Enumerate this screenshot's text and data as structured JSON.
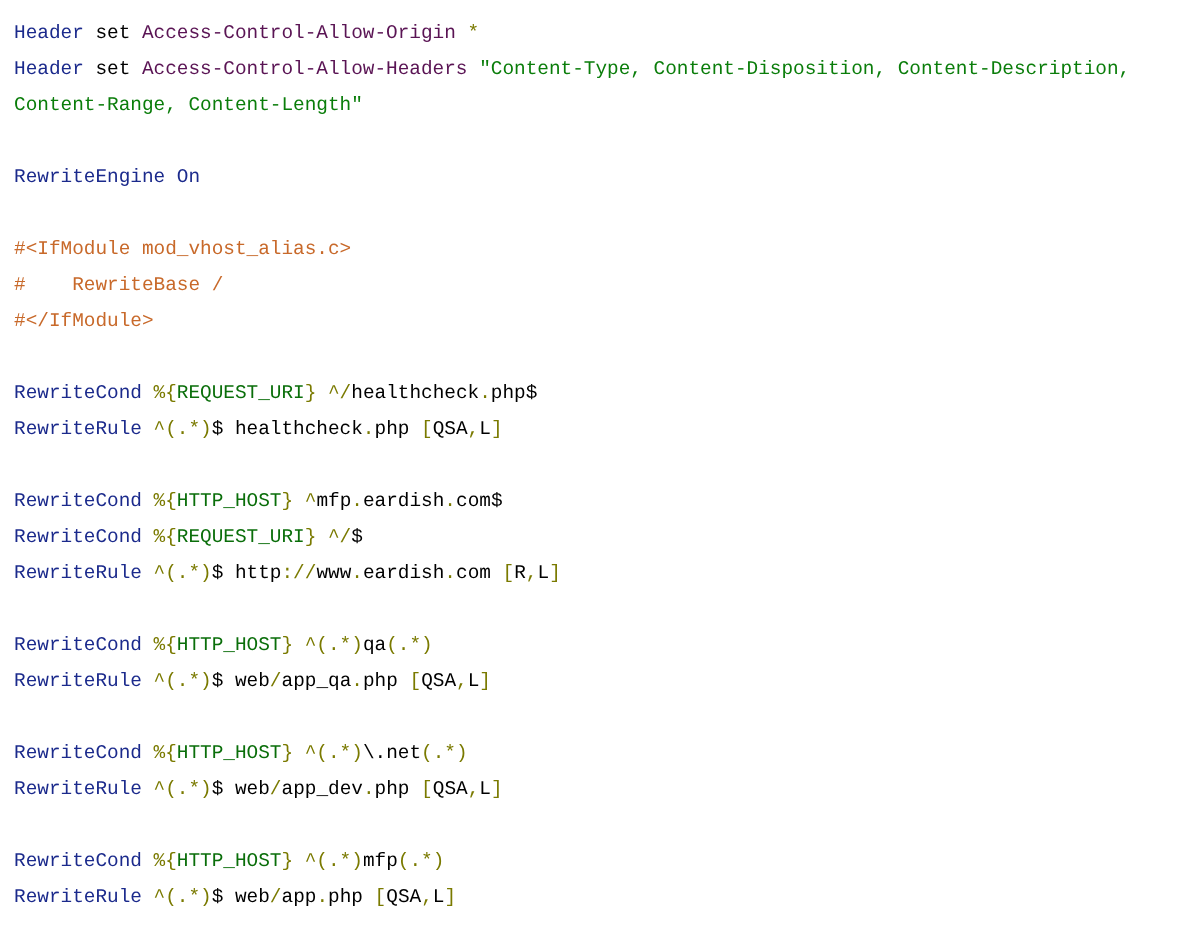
{
  "code_blocks": [
    {
      "lines": [
        {
          "tokens": [
            {
              "kind": "directive",
              "text": "Header"
            },
            {
              "kind": "plain",
              "text": " set "
            },
            {
              "kind": "name",
              "text": "Access-Control-Allow-Origin"
            },
            {
              "kind": "punct",
              "text": " *"
            }
          ]
        },
        {
          "tokens": [
            {
              "kind": "directive",
              "text": "Header"
            },
            {
              "kind": "plain",
              "text": " set "
            },
            {
              "kind": "name",
              "text": "Access-Control-Allow-Headers"
            },
            {
              "kind": "string",
              "text": " \"Content-Type, Content-Disposition, Content-Description, Content-Range, Content-Length\""
            }
          ]
        }
      ]
    },
    {
      "lines": [
        {
          "tokens": [
            {
              "kind": "directive",
              "text": "RewriteEngine"
            },
            {
              "kind": "directive",
              "text": " On"
            }
          ]
        }
      ]
    },
    {
      "lines": [
        {
          "tokens": [
            {
              "kind": "comment",
              "text": "#<IfModule mod_vhost_alias.c>"
            }
          ]
        },
        {
          "tokens": [
            {
              "kind": "comment",
              "text": "#    RewriteBase /"
            }
          ]
        },
        {
          "tokens": [
            {
              "kind": "comment",
              "text": "#</IfModule>"
            }
          ]
        }
      ]
    },
    {
      "lines": [
        {
          "tokens": [
            {
              "kind": "directive",
              "text": "RewriteCond"
            },
            {
              "kind": "punct",
              "text": " %{"
            },
            {
              "kind": "var",
              "text": "REQUEST_URI"
            },
            {
              "kind": "punct",
              "text": "} ^/"
            },
            {
              "kind": "plain",
              "text": "healthcheck"
            },
            {
              "kind": "punct",
              "text": "."
            },
            {
              "kind": "plain",
              "text": "php$"
            }
          ]
        },
        {
          "tokens": [
            {
              "kind": "directive",
              "text": "RewriteRule"
            },
            {
              "kind": "punct",
              "text": " ^(.*)"
            },
            {
              "kind": "plain",
              "text": "$ healthcheck"
            },
            {
              "kind": "punct",
              "text": "."
            },
            {
              "kind": "plain",
              "text": "php "
            },
            {
              "kind": "punct",
              "text": "["
            },
            {
              "kind": "plain",
              "text": "QSA"
            },
            {
              "kind": "punct",
              "text": ","
            },
            {
              "kind": "plain",
              "text": "L"
            },
            {
              "kind": "punct",
              "text": "]"
            }
          ]
        }
      ]
    },
    {
      "lines": [
        {
          "tokens": [
            {
              "kind": "directive",
              "text": "RewriteCond"
            },
            {
              "kind": "punct",
              "text": " %{"
            },
            {
              "kind": "var",
              "text": "HTTP_HOST"
            },
            {
              "kind": "punct",
              "text": "} ^"
            },
            {
              "kind": "plain",
              "text": "mfp"
            },
            {
              "kind": "punct",
              "text": "."
            },
            {
              "kind": "plain",
              "text": "eardish"
            },
            {
              "kind": "punct",
              "text": "."
            },
            {
              "kind": "plain",
              "text": "com$"
            }
          ]
        },
        {
          "tokens": [
            {
              "kind": "directive",
              "text": "RewriteCond"
            },
            {
              "kind": "punct",
              "text": " %{"
            },
            {
              "kind": "var",
              "text": "REQUEST_URI"
            },
            {
              "kind": "punct",
              "text": "} ^/"
            },
            {
              "kind": "plain",
              "text": "$"
            }
          ]
        },
        {
          "tokens": [
            {
              "kind": "directive",
              "text": "RewriteRule"
            },
            {
              "kind": "punct",
              "text": " ^(.*)"
            },
            {
              "kind": "plain",
              "text": "$ http"
            },
            {
              "kind": "punct",
              "text": "://"
            },
            {
              "kind": "plain",
              "text": "www"
            },
            {
              "kind": "punct",
              "text": "."
            },
            {
              "kind": "plain",
              "text": "eardish"
            },
            {
              "kind": "punct",
              "text": "."
            },
            {
              "kind": "plain",
              "text": "com "
            },
            {
              "kind": "punct",
              "text": "["
            },
            {
              "kind": "plain",
              "text": "R"
            },
            {
              "kind": "punct",
              "text": ","
            },
            {
              "kind": "plain",
              "text": "L"
            },
            {
              "kind": "punct",
              "text": "]"
            }
          ]
        }
      ]
    },
    {
      "lines": [
        {
          "tokens": [
            {
              "kind": "directive",
              "text": "RewriteCond"
            },
            {
              "kind": "punct",
              "text": " %{"
            },
            {
              "kind": "var",
              "text": "HTTP_HOST"
            },
            {
              "kind": "punct",
              "text": "} ^(.*)"
            },
            {
              "kind": "plain",
              "text": "qa"
            },
            {
              "kind": "punct",
              "text": "(.*)"
            }
          ]
        },
        {
          "tokens": [
            {
              "kind": "directive",
              "text": "RewriteRule"
            },
            {
              "kind": "punct",
              "text": " ^(.*)"
            },
            {
              "kind": "plain",
              "text": "$ web"
            },
            {
              "kind": "punct",
              "text": "/"
            },
            {
              "kind": "plain",
              "text": "app_qa"
            },
            {
              "kind": "punct",
              "text": "."
            },
            {
              "kind": "plain",
              "text": "php "
            },
            {
              "kind": "punct",
              "text": "["
            },
            {
              "kind": "plain",
              "text": "QSA"
            },
            {
              "kind": "punct",
              "text": ","
            },
            {
              "kind": "plain",
              "text": "L"
            },
            {
              "kind": "punct",
              "text": "]"
            }
          ]
        }
      ]
    },
    {
      "lines": [
        {
          "tokens": [
            {
              "kind": "directive",
              "text": "RewriteCond"
            },
            {
              "kind": "punct",
              "text": " %{"
            },
            {
              "kind": "var",
              "text": "HTTP_HOST"
            },
            {
              "kind": "punct",
              "text": "} ^(.*)"
            },
            {
              "kind": "plain",
              "text": "\\.net"
            },
            {
              "kind": "punct",
              "text": "(.*)"
            }
          ]
        },
        {
          "tokens": [
            {
              "kind": "directive",
              "text": "RewriteRule"
            },
            {
              "kind": "punct",
              "text": " ^(.*)"
            },
            {
              "kind": "plain",
              "text": "$ web"
            },
            {
              "kind": "punct",
              "text": "/"
            },
            {
              "kind": "plain",
              "text": "app_dev"
            },
            {
              "kind": "punct",
              "text": "."
            },
            {
              "kind": "plain",
              "text": "php "
            },
            {
              "kind": "punct",
              "text": "["
            },
            {
              "kind": "plain",
              "text": "QSA"
            },
            {
              "kind": "punct",
              "text": ","
            },
            {
              "kind": "plain",
              "text": "L"
            },
            {
              "kind": "punct",
              "text": "]"
            }
          ]
        }
      ]
    },
    {
      "lines": [
        {
          "tokens": [
            {
              "kind": "directive",
              "text": "RewriteCond"
            },
            {
              "kind": "punct",
              "text": " %{"
            },
            {
              "kind": "var",
              "text": "HTTP_HOST"
            },
            {
              "kind": "punct",
              "text": "} ^(.*)"
            },
            {
              "kind": "plain",
              "text": "mfp"
            },
            {
              "kind": "punct",
              "text": "(.*)"
            }
          ]
        },
        {
          "tokens": [
            {
              "kind": "directive",
              "text": "RewriteRule"
            },
            {
              "kind": "punct",
              "text": " ^(.*)"
            },
            {
              "kind": "plain",
              "text": "$ web"
            },
            {
              "kind": "punct",
              "text": "/"
            },
            {
              "kind": "plain",
              "text": "app"
            },
            {
              "kind": "punct",
              "text": "."
            },
            {
              "kind": "plain",
              "text": "php "
            },
            {
              "kind": "punct",
              "text": "["
            },
            {
              "kind": "plain",
              "text": "QSA"
            },
            {
              "kind": "punct",
              "text": ","
            },
            {
              "kind": "plain",
              "text": "L"
            },
            {
              "kind": "punct",
              "text": "]"
            }
          ]
        }
      ]
    }
  ]
}
